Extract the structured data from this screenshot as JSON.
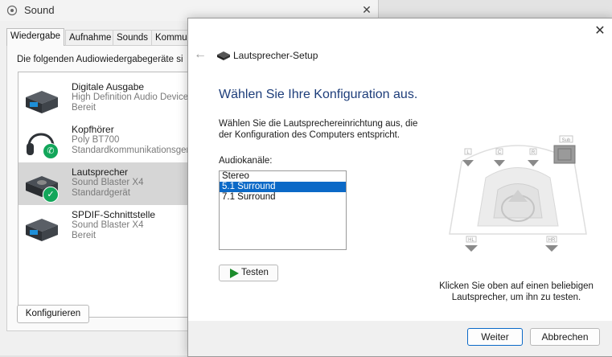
{
  "sound_window": {
    "title": "Sound",
    "tabs": [
      "Wiedergabe",
      "Aufnahme",
      "Sounds",
      "Kommuni"
    ],
    "instructions": "Die folgenden Audiowiedergabegeräte si",
    "devices": [
      {
        "name": "Digitale Ausgabe",
        "description": "High Definition Audio Device",
        "status": "Bereit",
        "icon": "digital-output-icon"
      },
      {
        "name": "Kopfhörer",
        "description": "Poly BT700",
        "status": "Standardkommunikationsgerät",
        "icon": "headphones-icon"
      },
      {
        "name": "Lautsprecher",
        "description": "Sound Blaster X4",
        "status": "Standardgerät",
        "icon": "speaker-device-icon"
      },
      {
        "name": "SPDIF-Schnittstelle",
        "description": "Sound Blaster X4",
        "status": "Bereit",
        "icon": "spdif-icon"
      }
    ],
    "configure_label": "Konfigurieren"
  },
  "dialog": {
    "title": "Lautsprecher-Setup",
    "heading": "Wählen Sie Ihre Konfiguration aus.",
    "instructions": "Wählen Sie die Lautsprechereinrichtung aus, die der Konfiguration des Computers entspricht.",
    "channels_label": "Audiokanäle:",
    "channels": [
      "Stereo",
      "5.1 Surround",
      "7.1 Surround"
    ],
    "selected_channel": "5.1 Surround",
    "test_label": "Testen",
    "speaker_labels": {
      "left": "L",
      "center": "C",
      "right": "R",
      "sub": "Sub",
      "rear_left": "HL",
      "rear_right": "HR"
    },
    "hint": "Klicken Sie oben auf einen beliebigen Lautsprecher, um ihn zu testen.",
    "next_label": "Weiter",
    "cancel_label": "Abbrechen"
  },
  "colors": {
    "heading": "#1d3d7a",
    "selection": "#0b69c7",
    "badge": "#12a65a",
    "play": "#1c8c2c"
  }
}
